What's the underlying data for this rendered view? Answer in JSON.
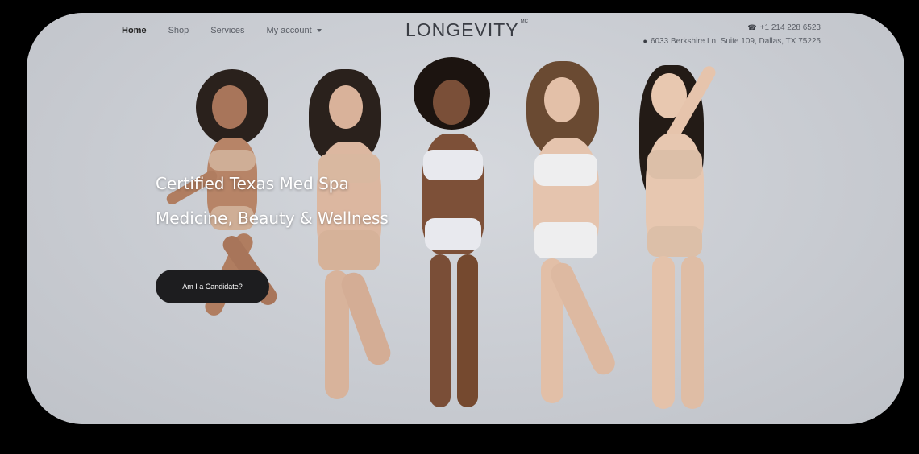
{
  "nav": {
    "items": [
      {
        "label": "Home",
        "active": true
      },
      {
        "label": "Shop"
      },
      {
        "label": "Services"
      },
      {
        "label": "My account",
        "dropdown": true
      }
    ]
  },
  "brand": {
    "name": "LONGEVITY",
    "mark": "MC"
  },
  "contact": {
    "phone": "+1 214 228 6523",
    "address": "6033 Berkshire Ln, Suite 109, Dallas, TX 75225",
    "phone_icon": "phone-icon",
    "address_icon": "map-pin-icon"
  },
  "hero": {
    "headline_1": "Certified Texas Med Spa",
    "headline_2": "Medicine, Beauty & Wellness",
    "cta_label": "Am I a Candidate?"
  },
  "colors": {
    "cta_bg": "#1d1d1f",
    "background": "#cdd0d6",
    "text_dark": "#3a3d44"
  }
}
